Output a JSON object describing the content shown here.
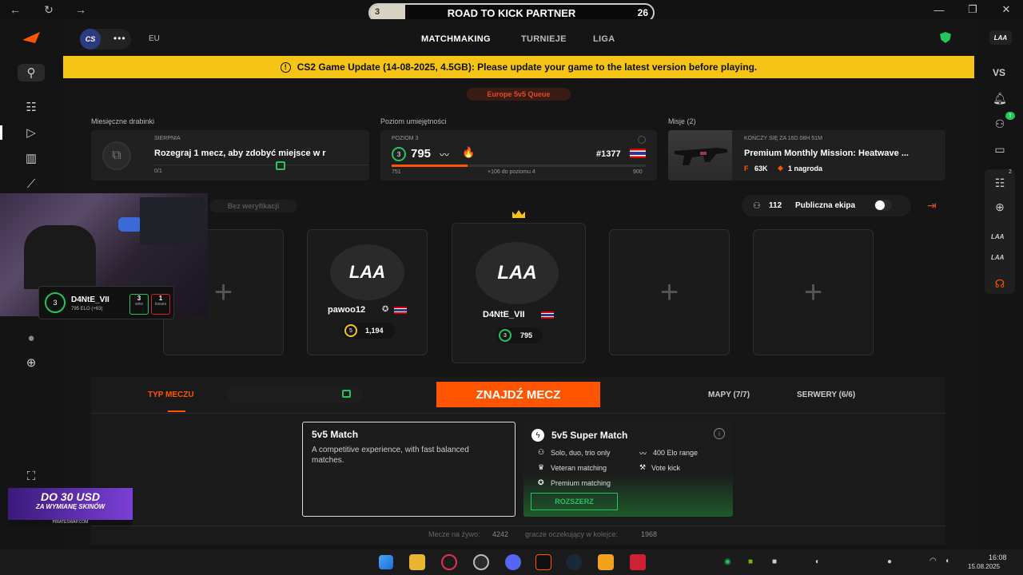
{
  "browser": {
    "kick_title": "ROAD TO KICK PARTNER",
    "kick_left": "3",
    "kick_right": "26"
  },
  "header": {
    "logo_text": "CS",
    "region": "EU",
    "tabs": [
      "MATCHMAKING",
      "TURNIEJE",
      "LIGA"
    ]
  },
  "banner": {
    "text": "CS2 Game Update (14-08-2025, 4.5GB): Please update your game to the latest version before playing."
  },
  "queue_badge": "Europe 5v5 Queue",
  "ladders": {
    "label": "Miesięczne drabinki",
    "month": "SIERPNIA",
    "text": "Rozegraj 1 mecz, aby zdobyć miejsce w r",
    "progress": "0/1"
  },
  "skill": {
    "label": "Poziom umiejętności",
    "level_label": "POZIOM 3",
    "level": "3",
    "elo": "795",
    "rank": "#1377",
    "min": "751",
    "to_next": "+106 do poziomu 4",
    "max": "900",
    "progress": 0.3
  },
  "missions": {
    "label": "Misje (2)",
    "timer": "KOŃCZY SIĘ ZA 16D 08H 51M",
    "title": "Premium Monthly Mission: Heatwave ...",
    "reward_points": "63K",
    "reward_count": "1 nagroda"
  },
  "party": {
    "verify": "Bez weryfikacji",
    "count": "112",
    "public_label": "Publiczna ekipa"
  },
  "players": [
    {
      "name": "pawoo12",
      "level": "5",
      "elo": "1,194"
    },
    {
      "name": "D4NtE_VII",
      "level": "3",
      "elo": "795"
    }
  ],
  "overlay": {
    "name": "D4NtE_VII",
    "elo": "795 ELO (+63)",
    "wins_num": "3",
    "wins_label": "wins",
    "losses_num": "1",
    "losses_label": "losses",
    "level": "3"
  },
  "promo": {
    "line1": "DO 30 USD",
    "line2": "ZA WYMIANĘ SKINÓW",
    "line3": "PIRATESWAP.COM"
  },
  "match": {
    "typ": "TYP MECZU",
    "find": "ZNAJDŹ MECZ",
    "maps": "MAPY (7/7)",
    "servers": "SERWERY (6/6)",
    "card1_title": "5v5 Match",
    "card1_desc": "A competitive experience, with fast balanced matches.",
    "card2_title": "5v5 Super Match",
    "feat1": "Solo, duo, trio only",
    "feat2": "400 Elo range",
    "feat3": "Veteran matching",
    "feat4": "Vote kick",
    "feat5": "Premium matching",
    "expand": "ROZSZERZ"
  },
  "footer": {
    "live_label": "Mecze na żywo:",
    "live": "4242",
    "queue_label": "gracze oczekujący w kolejce:",
    "queue": "1968"
  },
  "right": {
    "vs": "VS",
    "friend_badge": "1",
    "party_badge": "2"
  },
  "clock": {
    "time": "16:08",
    "date": "15.08.2025"
  },
  "colors": {
    "accent": "#ff5500",
    "banner": "#f5c417",
    "green": "#22c55e"
  }
}
